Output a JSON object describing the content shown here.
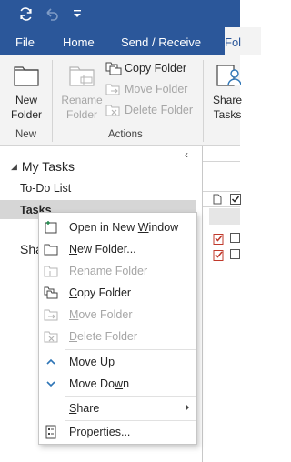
{
  "quick_access": {
    "icons": [
      "sync-icon",
      "undo-icon",
      "customize-quick-access-icon"
    ]
  },
  "ribbon_tabs": {
    "file": "File",
    "home": "Home",
    "send_receive": "Send / Receive",
    "folder": "Fol"
  },
  "ribbon": {
    "new_group": {
      "new_folder_line1": "New",
      "new_folder_line2": "Folder",
      "label": "New"
    },
    "actions_group": {
      "rename_line1": "Rename",
      "rename_line2": "Folder",
      "copy_folder": "Copy Folder",
      "move_folder": "Move Folder",
      "delete_folder": "Delete Folder",
      "label": "Actions"
    },
    "share_group": {
      "share_line1": "Share",
      "share_line2": "Tasks"
    }
  },
  "nav": {
    "collapse_glyph": "‹",
    "my_tasks_glyph": "◢",
    "my_tasks": "My Tasks",
    "items": [
      {
        "label": "To-Do List"
      },
      {
        "label": "Tasks"
      }
    ],
    "shared_partial": "Sha"
  },
  "context_menu": {
    "items": [
      {
        "pre": "Open in New ",
        "u": "W",
        "post": "indow",
        "enabled": true,
        "icon": "open-new-window-icon"
      },
      {
        "pre": "",
        "u": "N",
        "post": "ew Folder...",
        "enabled": true,
        "icon": "new-folder-icon"
      },
      {
        "pre": "",
        "u": "R",
        "post": "ename Folder",
        "enabled": false,
        "icon": "rename-folder-icon"
      },
      {
        "pre": "",
        "u": "C",
        "post": "opy Folder",
        "enabled": true,
        "icon": "copy-folder-icon"
      },
      {
        "pre": "",
        "u": "M",
        "post": "ove Folder",
        "enabled": false,
        "icon": "move-folder-icon"
      },
      {
        "pre": "",
        "u": "D",
        "post": "elete Folder",
        "enabled": false,
        "icon": "delete-folder-icon"
      },
      {
        "pre": "Move ",
        "u": "U",
        "post": "p",
        "enabled": true,
        "icon": "chevron-up-icon"
      },
      {
        "pre": "Move Do",
        "u": "w",
        "post": "n",
        "enabled": true,
        "icon": "chevron-down-icon"
      },
      {
        "pre": "",
        "u": "S",
        "post": "hare",
        "enabled": true,
        "icon": "share-submenu"
      },
      {
        "pre": "",
        "u": "P",
        "post": "roperties...",
        "enabled": true,
        "icon": "properties-icon"
      }
    ]
  },
  "colors": {
    "brand": "#2b579a",
    "ribbon_bg": "#f3f3f3",
    "selected_row": "#d6d6d6",
    "disabled_text": "#a6a6a6",
    "accent_blue": "#2e75b6",
    "task_red": "#c0392b"
  }
}
